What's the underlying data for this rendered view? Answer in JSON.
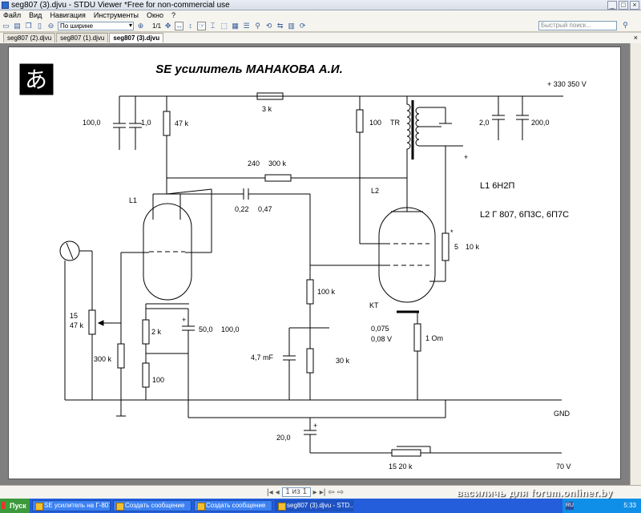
{
  "window": {
    "title": "seg807 (3).djvu - STDU Viewer *Free for non-commercial use",
    "min": "_",
    "max": "□",
    "close": "×"
  },
  "menu": [
    "Файл",
    "Вид",
    "Навигация",
    "Инструменты",
    "Окно",
    "?"
  ],
  "toolbar": {
    "zoom_value": "По ширине",
    "page_ratio": "1/1",
    "search_placeholder": "Быстрый поиск..."
  },
  "tabs": [
    {
      "label": "seg807 (2).djvu",
      "active": false
    },
    {
      "label": "seg807 (1).djvu",
      "active": false
    },
    {
      "label": "seg807 (3).djvu",
      "active": true
    }
  ],
  "schematic": {
    "logo": "あ",
    "title": "SE усилитель МАНАКОВА А.И.",
    "supply": "+ 330   350 V",
    "r_3k": "3 k",
    "r_47k": "47 k",
    "c_100": "100,0",
    "c_1": "1,0",
    "r_100": "100",
    "tr": "TR",
    "c_2": "2,0",
    "c_200": "200,0",
    "r_240": "240",
    "r_300k": "300 k",
    "l1": "L1",
    "l2": "L2",
    "c_022": "0,22",
    "c_047": "0,47",
    "legend_l1": "L1    6Н2П",
    "legend_l2": "L2    Г 807, 6П3С, 6П7С",
    "r_5": "5",
    "r_10k": "10 k",
    "star": "*",
    "plus": "+",
    "pot_15": "15",
    "pot_47k": "47 k",
    "r_2k": "2 k",
    "c_50": "50,0",
    "c_100b": "100,0",
    "r_100k": "100 k",
    "kt": "KT",
    "r_300k_b": "300 k",
    "r_100_b": "100",
    "c_47mf": "4,7 mF",
    "r_30k": "30 k",
    "v_0075": "0,075",
    "v_008": "0,08 V",
    "r_1om": "1 Om",
    "gnd": "GND",
    "c_20": "20,0",
    "r_1520k": "15 20 k",
    "v_70": "70 V"
  },
  "status": {
    "page_of": "1 из 1",
    "watermark": "василичь для forum.onliner.by"
  },
  "taskbar": {
    "start": "Пуск",
    "tasks": [
      {
        "label": "SE усилитель на Г-807 ...",
        "active": false
      },
      {
        "label": "Создать сообщение",
        "active": false
      },
      {
        "label": "Создать сообщение",
        "active": false
      },
      {
        "label": "seg807 (3).djvu - STD...",
        "active": true
      }
    ],
    "lang": "RU",
    "clock": "5:33"
  }
}
